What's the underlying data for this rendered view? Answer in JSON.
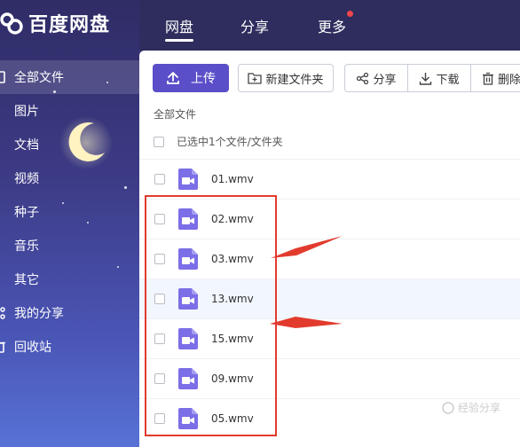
{
  "app": {
    "logo_text": "百度网盘"
  },
  "topnav": [
    {
      "label": "网盘",
      "active": true
    },
    {
      "label": "分享",
      "active": false
    },
    {
      "label": "更多",
      "active": false,
      "badge": true
    }
  ],
  "sidebar": {
    "items": [
      {
        "label": "全部文件",
        "active": true,
        "icon": "file-icon"
      },
      {
        "label": "图片"
      },
      {
        "label": "文档"
      },
      {
        "label": "视频"
      },
      {
        "label": "种子"
      },
      {
        "label": "音乐"
      },
      {
        "label": "其它"
      },
      {
        "label": "我的分享",
        "icon": "share-icon"
      },
      {
        "label": "回收站",
        "icon": "trash-icon"
      }
    ]
  },
  "toolbar": {
    "upload_label": "上传",
    "new_folder_label": "新建文件夹",
    "share_label": "分享",
    "download_label": "下载",
    "delete_label": "删除"
  },
  "breadcrumb": "全部文件",
  "selection": {
    "text": "已选中1个文件/文件夹"
  },
  "files": [
    {
      "name": "01.wmv",
      "type": "video-file-icon"
    },
    {
      "name": "02.wmv",
      "type": "video-file-icon"
    },
    {
      "name": "03.wmv",
      "type": "video-file-icon"
    },
    {
      "name": "13.wmv",
      "type": "video-file-icon",
      "highlighted": true
    },
    {
      "name": "15.wmv",
      "type": "video-file-icon"
    },
    {
      "name": "09.wmv",
      "type": "video-file-icon"
    },
    {
      "name": "05.wmv",
      "type": "video-file-icon"
    }
  ],
  "watermark": "经验分享",
  "colors": {
    "accent": "#5a4fc8",
    "header_bg": "#2e2d5e",
    "annotation_red": "#e23b2e",
    "file_icon": "#7b6ee6"
  }
}
